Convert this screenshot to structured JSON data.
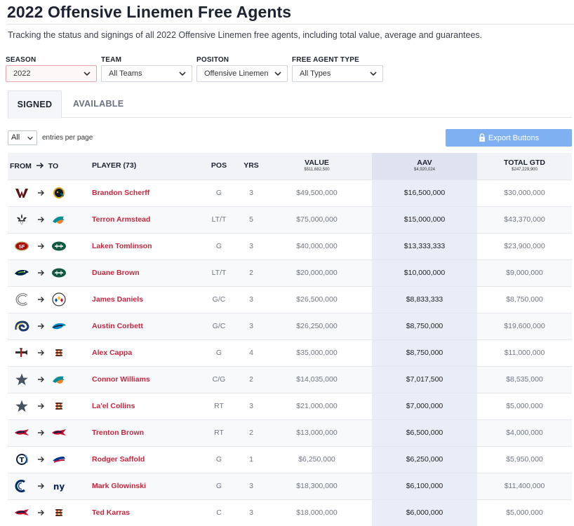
{
  "page": {
    "title": "2022 Offensive Linemen Free Agents",
    "subtitle": "Tracking the status and signings of all 2022 Offensive Linemen free agents, including total value, average and guarantees."
  },
  "filters": [
    {
      "label": "SEASON",
      "value": "2022"
    },
    {
      "label": "TEAM",
      "value": "All Teams"
    },
    {
      "label": "POSITON",
      "value": "Offensive Linemen"
    },
    {
      "label": "FREE AGENT TYPE",
      "value": "All Types"
    }
  ],
  "tabs": {
    "signed": "SIGNED",
    "available": "AVAILABLE"
  },
  "entries": {
    "value": "All",
    "suffix": "entries per page"
  },
  "export_label": "Export Buttons",
  "colors": {
    "accent": "#c3283e",
    "export": "#7fb0f2",
    "aav_column": "#e9edf8"
  },
  "table": {
    "headers": {
      "from": "FROM",
      "to": "TO",
      "player": "PLAYER (73)",
      "pos": "POS",
      "yrs": "YRS",
      "value": "VALUE",
      "value_total": "$511,682,500",
      "aav": "AAV",
      "aav_total": "$4,920,024",
      "gtd": "TOTAL GTD",
      "gtd_total": "$247,229,900"
    },
    "rows": [
      {
        "from_icon": "washington-logo-icon",
        "to_icon": "jaguars-logo-icon",
        "player": "Brandon Scherff",
        "pos": "G",
        "yrs": "3",
        "value": "$49,500,000",
        "aav": "$16,500,000",
        "gtd": "$30,000,000"
      },
      {
        "from_icon": "saints-logo-icon",
        "to_icon": "dolphins-logo-icon",
        "player": "Terron Armstead",
        "pos": "LT/T",
        "yrs": "5",
        "value": "$75,000,000",
        "aav": "$15,000,000",
        "gtd": "$43,370,000"
      },
      {
        "from_icon": "49ers-logo-icon",
        "to_icon": "jets-logo-icon",
        "player": "Laken Tomlinson",
        "pos": "G",
        "yrs": "3",
        "value": "$40,000,000",
        "aav": "$13,333,333",
        "gtd": "$23,900,000"
      },
      {
        "from_icon": "seahawks-logo-icon",
        "to_icon": "jets-logo-icon",
        "player": "Duane Brown",
        "pos": "LT/T",
        "yrs": "2",
        "value": "$20,000,000",
        "aav": "$10,000,000",
        "gtd": "$9,000,000"
      },
      {
        "from_icon": "bears-logo-icon",
        "to_icon": "steelers-logo-icon",
        "player": "James Daniels",
        "pos": "G/C",
        "yrs": "3",
        "value": "$26,500,000",
        "aav": "$8,833,333",
        "gtd": "$8,750,000"
      },
      {
        "from_icon": "rams-logo-icon",
        "to_icon": "panthers-logo-icon",
        "player": "Austin Corbett",
        "pos": "G/C",
        "yrs": "3",
        "value": "$26,250,000",
        "aav": "$8,750,000",
        "gtd": "$19,600,000"
      },
      {
        "from_icon": "buccaneers-logo-icon",
        "to_icon": "bengals-logo-icon",
        "player": "Alex Cappa",
        "pos": "G",
        "yrs": "4",
        "value": "$35,000,000",
        "aav": "$8,750,000",
        "gtd": "$11,000,000"
      },
      {
        "from_icon": "cowboys-logo-icon",
        "to_icon": "dolphins-logo-icon",
        "player": "Connor Williams",
        "pos": "C/G",
        "yrs": "2",
        "value": "$14,035,000",
        "aav": "$7,017,500",
        "gtd": "$8,535,000"
      },
      {
        "from_icon": "cowboys-logo-icon",
        "to_icon": "bengals-logo-icon",
        "player": "La'el Collins",
        "pos": "RT",
        "yrs": "3",
        "value": "$21,000,000",
        "aav": "$7,000,000",
        "gtd": "$5,000,000"
      },
      {
        "from_icon": "patriots-logo-icon",
        "to_icon": "patriots-logo-icon",
        "player": "Trenton Brown",
        "pos": "RT",
        "yrs": "2",
        "value": "$13,000,000",
        "aav": "$6,500,000",
        "gtd": "$4,000,000"
      },
      {
        "from_icon": "titans-logo-icon",
        "to_icon": "bills-logo-icon",
        "player": "Rodger Saffold",
        "pos": "G",
        "yrs": "1",
        "value": "$6,250,000",
        "aav": "$6,250,000",
        "gtd": "$5,950,000"
      },
      {
        "from_icon": "colts-logo-icon",
        "to_icon": "giants-logo-icon",
        "player": "Mark Glowinski",
        "pos": "G",
        "yrs": "3",
        "value": "$18,300,000",
        "aav": "$6,100,000",
        "gtd": "$11,400,000"
      },
      {
        "from_icon": "patriots-logo-icon",
        "to_icon": "bengals-logo-icon",
        "player": "Ted Karras",
        "pos": "C",
        "yrs": "3",
        "value": "$18,000,000",
        "aav": "$6,000,000",
        "gtd": "$5,000,000"
      }
    ]
  }
}
